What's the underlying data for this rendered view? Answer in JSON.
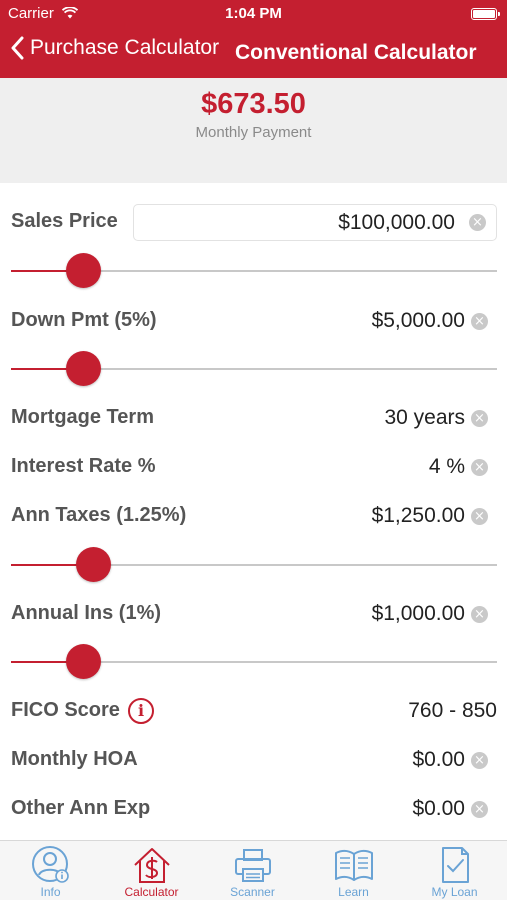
{
  "status_bar": {
    "carrier": "Carrier",
    "time": "1:04 PM"
  },
  "nav": {
    "back_label": "Purchase Calculator",
    "title": "Conventional Calculator"
  },
  "summary": {
    "amount": "$673.50",
    "label": "Monthly Payment"
  },
  "fields": {
    "sales_price": {
      "label": "Sales Price",
      "value": "$100,000.00",
      "slider_level": 0.15
    },
    "down_pmt": {
      "label": "Down Pmt (5%)",
      "value": "$5,000.00",
      "slider_level": 0.15
    },
    "mortgage_term": {
      "label": "Mortgage Term",
      "value": "30 years"
    },
    "interest_rate": {
      "label": "Interest Rate %",
      "value": "4 %"
    },
    "ann_taxes": {
      "label": "Ann Taxes (1.25%)",
      "value": "$1,250.00",
      "slider_level": 0.17
    },
    "annual_ins": {
      "label": "Annual Ins (1%)",
      "value": "$1,000.00",
      "slider_level": 0.15
    },
    "fico_score": {
      "label": "FICO Score",
      "value": "760 - 850",
      "info_glyph": "i"
    },
    "monthly_hoa": {
      "label": "Monthly HOA",
      "value": "$0.00"
    },
    "other_ann_exp": {
      "label": "Other Ann Exp",
      "value": "$0.00"
    }
  },
  "clear_glyph": "×",
  "tabs": [
    {
      "label": "Info",
      "icon": "person-info-icon"
    },
    {
      "label": "Calculator",
      "icon": "house-dollar-icon",
      "active": true
    },
    {
      "label": "Scanner",
      "icon": "printer-icon"
    },
    {
      "label": "Learn",
      "icon": "book-icon"
    },
    {
      "label": "My Loan",
      "icon": "document-check-icon"
    }
  ],
  "colors": {
    "accent": "#c41f30",
    "tab_inactive": "#6aa3d5",
    "summary_bg": "#efefef"
  }
}
